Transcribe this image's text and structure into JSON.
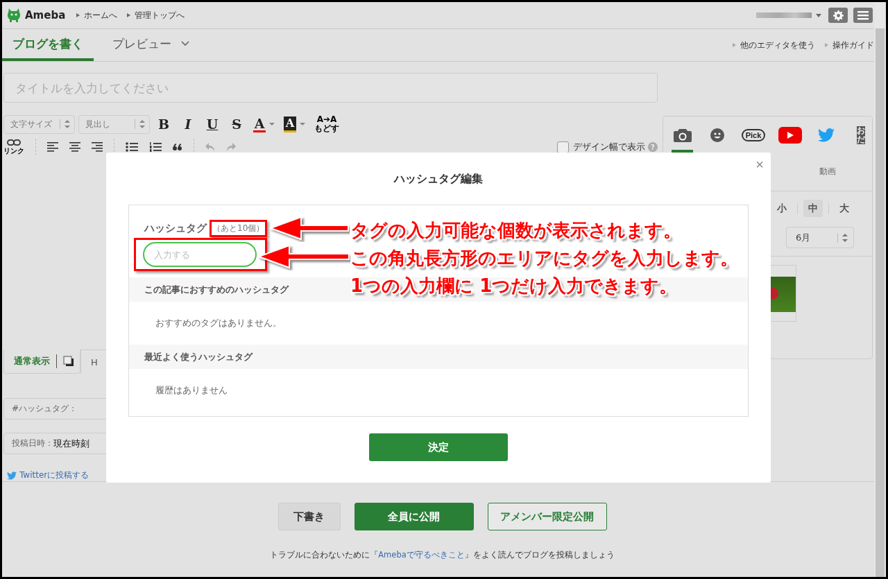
{
  "header": {
    "logo": "Ameba",
    "links": [
      "ホームへ",
      "管理トップへ"
    ]
  },
  "tabs": [
    {
      "label": "ブログを書く",
      "selected": true
    },
    {
      "label": "プレビュー",
      "selected": false
    }
  ],
  "header_links": [
    "他のエディタを使う",
    "操作ガイド"
  ],
  "title_field": {
    "placeholder": "タイトルを入力してください"
  },
  "toolbar": {
    "selects": [
      "文字サイズ",
      "見出し"
    ],
    "format_buttons": [
      {
        "kind": "bold",
        "label": "B"
      },
      {
        "kind": "italic",
        "label": "I"
      },
      {
        "kind": "underline",
        "label": "U"
      },
      {
        "kind": "strike",
        "label": "S"
      },
      {
        "kind": "color",
        "label": "A"
      },
      {
        "kind": "highlight",
        "label": "A"
      }
    ],
    "reset": {
      "top": "A➔A",
      "bottom": "もどす"
    },
    "link_label": "リンク",
    "design_width": {
      "label": "デザイン幅で表示",
      "checked": false,
      "help": "?"
    }
  },
  "mode_tabs": [
    {
      "label": "通常表示",
      "selected": true
    },
    {
      "label": "H",
      "selected": false
    }
  ],
  "hashtag_field": {
    "label": "#ハッシュタグ："
  },
  "post_date": {
    "label": "投稿日時：",
    "value": "現在時刻"
  },
  "twitter_link": "Twitterに投稿する",
  "side_panel": {
    "tools": [
      {
        "kind": "photo",
        "selected": true
      },
      {
        "kind": "emoji",
        "selected": false
      },
      {
        "kind": "pick",
        "label": "Pick",
        "selected": false
      },
      {
        "kind": "youtube",
        "selected": false
      },
      {
        "kind": "twitter",
        "selected": false
      },
      {
        "kind": "text",
        "label": "おだ",
        "selected": false
      }
    ],
    "sub_tab": "動画",
    "sizes": [
      {
        "label": "小",
        "selected": false
      },
      {
        "label": "中",
        "selected": true
      },
      {
        "label": "大",
        "selected": false
      }
    ],
    "month": "6月"
  },
  "footer": {
    "buttons": [
      {
        "kind": "draft",
        "label": "下書き"
      },
      {
        "kind": "publish",
        "label": "全員に公開"
      },
      {
        "kind": "members",
        "label": "アメンバー限定公開"
      }
    ],
    "notice": {
      "before": "トラブルに合わないために",
      "link": "『Amebaで守るべきこと』",
      "after": "をよく読んでブログを投稿しましょう"
    }
  },
  "modal": {
    "title": "ハッシュタグ編集",
    "close": "×",
    "field_label": "ハッシュタグ",
    "remaining": {
      "text": "（あと10個）",
      "highlighted": true
    },
    "input": {
      "placeholder": "入力する",
      "highlighted": true
    },
    "sections": [
      {
        "heading": "この記事におすすめのハッシュタグ",
        "empty_text": "おすすめのタグはありません。"
      },
      {
        "heading": "最近よく使うハッシュタグ",
        "empty_text": "履歴はありません"
      }
    ],
    "confirm": "決定"
  },
  "annotations": [
    "タグの入力可能な個数が表示されます。",
    "この角丸長方形のエリアにタグを入力します。",
    "1つの入力欄に 1つだけ入力できます。"
  ]
}
